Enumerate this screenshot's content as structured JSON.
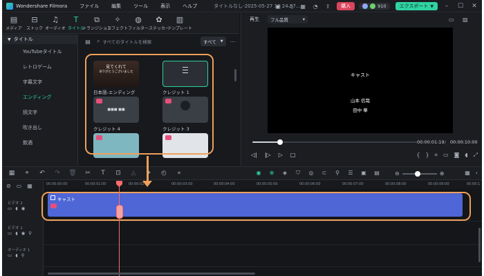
{
  "app": {
    "name": "Wondershare Filmora",
    "doc_title": "タイトルなし-2025-05-27 10 24 57..."
  },
  "menu": [
    "ファイル",
    "編集",
    "ツール",
    "表示",
    "ヘルプ"
  ],
  "titlebar": {
    "buy_label": "購入",
    "credits": "910",
    "export_label": "エクスポート"
  },
  "media_tabs": [
    {
      "label": "メディア",
      "icon": "media-icon"
    },
    {
      "label": "ストック",
      "icon": "stock-icon"
    },
    {
      "label": "オーディオ",
      "icon": "audio-icon"
    },
    {
      "label": "タイトル",
      "icon": "title-icon",
      "active": true
    },
    {
      "label": "トランジション",
      "icon": "transition-icon"
    },
    {
      "label": "エフェクト",
      "icon": "effect-icon"
    },
    {
      "label": "フィルター",
      "icon": "filter-icon"
    },
    {
      "label": "ステッカー",
      "icon": "sticker-icon"
    },
    {
      "label": "テンプレート",
      "icon": "template-icon"
    }
  ],
  "categories": {
    "header": "タイトル",
    "items": [
      "YouTubeタイトル",
      "レトロゲーム",
      "字幕文字",
      "エンディング",
      "読文字",
      "吹き出し",
      "飲酒"
    ],
    "active_index": 3
  },
  "browser": {
    "search_placeholder": "すべてのタイトルを検索",
    "filter_label": "すべて",
    "thumbnails": [
      {
        "label": "日本語-エンディング",
        "preview_line1": "見てくれて",
        "preview_line2": "ありがとうございました"
      },
      {
        "label": "クレジット 1"
      },
      {
        "label": "クレジット 4"
      },
      {
        "label": "クレジット 3"
      }
    ]
  },
  "preview": {
    "label": "再生",
    "quality": "フル品質",
    "screen_lines": [
      "キャスト",
      "山本 信哉",
      "田中 華"
    ],
    "current_time": "00:00:01:19",
    "total_time": "00:00:10:00",
    "progress": 0.17
  },
  "timeline": {
    "ruler": [
      "00:00:00:00",
      "00:00:01:00",
      "00:00:02:00",
      "00:00:03:00",
      "00:00:04:00",
      "00:00:05:00",
      "00:00:06:00",
      "00:00:07:00",
      "00:00:08:00",
      "00:00:09:00",
      "00:00:1"
    ],
    "tracks": [
      {
        "name": "ビデオ 2"
      },
      {
        "name": "ビデオ 1"
      },
      {
        "name": "オーディオ 1"
      }
    ],
    "clip_name": "キャスト",
    "zoom_level": 0.45
  }
}
